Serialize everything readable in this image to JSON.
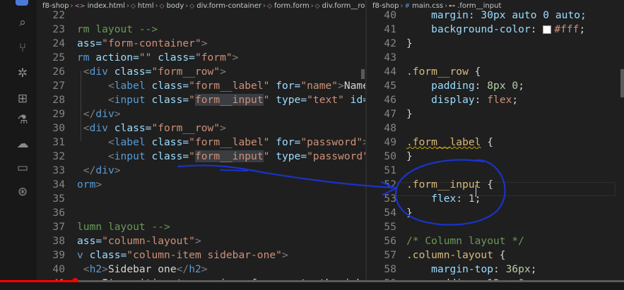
{
  "activity_bar": {
    "icons": [
      "files-icon",
      "search-icon",
      "source-control-icon",
      "debug-icon",
      "extensions-icon",
      "testing-icon",
      "docker-icon",
      "remote-explorer-icon",
      "git-graph-icon"
    ]
  },
  "left_editor": {
    "breadcrumb": [
      {
        "icon": "folder",
        "label": "f8-shop"
      },
      {
        "icon": "html",
        "label": "index.html"
      },
      {
        "icon": "element",
        "label": "html"
      },
      {
        "icon": "element",
        "label": "body"
      },
      {
        "icon": "element",
        "label": "div.form-container"
      },
      {
        "icon": "element",
        "label": "form.form"
      },
      {
        "icon": "element",
        "label": "div.form__row"
      },
      {
        "icon": "element",
        "label": ""
      }
    ],
    "lines": [
      {
        "num": "22",
        "tokens": []
      },
      {
        "num": "23",
        "tokens": [
          {
            "t": "rm layout -->",
            "c": "c-cm"
          }
        ]
      },
      {
        "num": "24",
        "tokens": [
          {
            "t": "ass=",
            "c": "c-attr"
          },
          {
            "t": "\"form-container\"",
            "c": "c-str"
          },
          {
            "t": ">",
            "c": "c-punc"
          }
        ]
      },
      {
        "num": "25",
        "tokens": [
          {
            "t": "rm ",
            "c": "c-tag"
          },
          {
            "t": "action=",
            "c": "c-attr"
          },
          {
            "t": "\"\" ",
            "c": "c-str"
          },
          {
            "t": "class=",
            "c": "c-attr"
          },
          {
            "t": "\"form\"",
            "c": "c-str"
          },
          {
            "t": ">",
            "c": "c-punc"
          }
        ]
      },
      {
        "num": "26",
        "tokens": [
          {
            "t": " ",
            "c": "c-plain"
          },
          {
            "t": "<",
            "c": "c-punc"
          },
          {
            "t": "div ",
            "c": "c-tag"
          },
          {
            "t": "class=",
            "c": "c-attr"
          },
          {
            "t": "\"form__row\"",
            "c": "c-str"
          },
          {
            "t": ">",
            "c": "c-punc"
          }
        ]
      },
      {
        "num": "27",
        "tokens": [
          {
            "t": "     ",
            "c": "c-plain"
          },
          {
            "t": "<",
            "c": "c-punc"
          },
          {
            "t": "label ",
            "c": "c-tag"
          },
          {
            "t": "class=",
            "c": "c-attr"
          },
          {
            "t": "\"form__label\" ",
            "c": "c-str"
          },
          {
            "t": "for=",
            "c": "c-attr"
          },
          {
            "t": "\"name\"",
            "c": "c-str"
          },
          {
            "t": ">",
            "c": "c-punc"
          },
          {
            "t": "Name:",
            "c": "c-plain"
          },
          {
            "t": "</l",
            "c": "c-punc"
          }
        ]
      },
      {
        "num": "28",
        "tokens": [
          {
            "t": "     ",
            "c": "c-plain"
          },
          {
            "t": "<",
            "c": "c-punc"
          },
          {
            "t": "input ",
            "c": "c-tag"
          },
          {
            "t": "class=",
            "c": "c-attr"
          },
          {
            "t": "\"",
            "c": "c-str"
          },
          {
            "t": "form__input",
            "c": "c-str hl"
          },
          {
            "t": "\" ",
            "c": "c-str"
          },
          {
            "t": "type=",
            "c": "c-attr"
          },
          {
            "t": "\"text\" ",
            "c": "c-str"
          },
          {
            "t": "id=",
            "c": "c-attr"
          },
          {
            "t": "\"nam",
            "c": "c-str"
          }
        ]
      },
      {
        "num": "29",
        "tokens": [
          {
            "t": " ",
            "c": "c-plain"
          },
          {
            "t": "</",
            "c": "c-punc"
          },
          {
            "t": "div",
            "c": "c-tag"
          },
          {
            "t": ">",
            "c": "c-punc"
          }
        ]
      },
      {
        "num": "30",
        "tokens": [
          {
            "t": " ",
            "c": "c-plain"
          },
          {
            "t": "<",
            "c": "c-punc"
          },
          {
            "t": "div ",
            "c": "c-tag"
          },
          {
            "t": "class=",
            "c": "c-attr"
          },
          {
            "t": "\"form__row\"",
            "c": "c-str"
          },
          {
            "t": ">",
            "c": "c-punc"
          }
        ]
      },
      {
        "num": "31",
        "tokens": [
          {
            "t": "     ",
            "c": "c-plain"
          },
          {
            "t": "<",
            "c": "c-punc"
          },
          {
            "t": "label ",
            "c": "c-tag"
          },
          {
            "t": "class=",
            "c": "c-attr"
          },
          {
            "t": "\"form__label\" ",
            "c": "c-str"
          },
          {
            "t": "for=",
            "c": "c-attr"
          },
          {
            "t": "\"password\"",
            "c": "c-str"
          },
          {
            "t": ">",
            "c": "c-punc"
          },
          {
            "t": "Pass",
            "c": "c-plain"
          }
        ]
      },
      {
        "num": "32",
        "tokens": [
          {
            "t": "     ",
            "c": "c-plain"
          },
          {
            "t": "<",
            "c": "c-punc"
          },
          {
            "t": "input ",
            "c": "c-tag"
          },
          {
            "t": "class=",
            "c": "c-attr"
          },
          {
            "t": "\"",
            "c": "c-str"
          },
          {
            "t": "form__input",
            "c": "c-str hl"
          },
          {
            "t": "\" ",
            "c": "c-str"
          },
          {
            "t": "type=",
            "c": "c-attr"
          },
          {
            "t": "\"password\" ",
            "c": "c-str"
          },
          {
            "t": "id=",
            "c": "c-attr"
          }
        ]
      },
      {
        "num": "33",
        "tokens": [
          {
            "t": " ",
            "c": "c-plain"
          },
          {
            "t": "</",
            "c": "c-punc"
          },
          {
            "t": "div",
            "c": "c-tag"
          },
          {
            "t": ">",
            "c": "c-punc"
          }
        ]
      },
      {
        "num": "34",
        "tokens": [
          {
            "t": "orm",
            "c": "c-tag"
          },
          {
            "t": ">",
            "c": "c-punc"
          }
        ]
      },
      {
        "num": "35",
        "tokens": []
      },
      {
        "num": "36",
        "tokens": []
      },
      {
        "num": "37",
        "tokens": [
          {
            "t": "lumn layout -->",
            "c": "c-cm"
          }
        ]
      },
      {
        "num": "38",
        "tokens": [
          {
            "t": "ass=",
            "c": "c-attr"
          },
          {
            "t": "\"column-layout\"",
            "c": "c-str"
          },
          {
            "t": ">",
            "c": "c-punc"
          }
        ]
      },
      {
        "num": "39",
        "tokens": [
          {
            "t": "v ",
            "c": "c-tag"
          },
          {
            "t": "class=",
            "c": "c-attr"
          },
          {
            "t": "\"column-item sidebar-one\"",
            "c": "c-str"
          },
          {
            "t": ">",
            "c": "c-punc"
          }
        ]
      },
      {
        "num": "40",
        "tokens": [
          {
            "t": " ",
            "c": "c-plain"
          },
          {
            "t": "<",
            "c": "c-punc"
          },
          {
            "t": "h2",
            "c": "c-tag"
          },
          {
            "t": ">",
            "c": "c-punc"
          },
          {
            "t": "Sidebar one",
            "c": "c-plain"
          },
          {
            "t": "</",
            "c": "c-punc"
          },
          {
            "t": "h2",
            "c": "c-tag"
          },
          {
            "t": ">",
            "c": "c-punc"
          }
        ]
      },
      {
        "num": "41",
        "tokens": [
          {
            "t": " ",
            "c": "c-plain"
          },
          {
            "t": "<",
            "c": "c-punc"
          },
          {
            "t": "p",
            "c": "c-tag"
          },
          {
            "t": ">",
            "c": "c-punc"
          },
          {
            "t": "I'm writing to you in reference to the job posi",
            "c": "c-plain"
          }
        ]
      }
    ]
  },
  "right_editor": {
    "breadcrumb": [
      {
        "icon": "folder",
        "label": "f8-shop"
      },
      {
        "icon": "css",
        "label": "main.css"
      },
      {
        "icon": "selector",
        "label": ".form__input"
      }
    ],
    "lines": [
      {
        "num": "40",
        "tokens": [
          {
            "t": "    margin: 30px auto 0 auto;",
            "c": "c-prop"
          }
        ]
      },
      {
        "num": "41",
        "tokens": [
          {
            "t": "    ",
            "c": "c-plain"
          },
          {
            "t": "background-color",
            "c": "c-prop"
          },
          {
            "t": ": ",
            "c": "c-plain"
          },
          {
            "t": "SWATCH",
            "c": "swatch"
          },
          {
            "t": "#fff",
            "c": "c-val"
          },
          {
            "t": ";",
            "c": "c-plain"
          }
        ]
      },
      {
        "num": "42",
        "tokens": [
          {
            "t": "}",
            "c": "c-brace"
          }
        ]
      },
      {
        "num": "43",
        "tokens": []
      },
      {
        "num": "44",
        "tokens": [
          {
            "t": ".form__row",
            "c": "c-sel"
          },
          {
            "t": " {",
            "c": "c-brace"
          }
        ]
      },
      {
        "num": "45",
        "tokens": [
          {
            "t": "    ",
            "c": "c-plain"
          },
          {
            "t": "padding",
            "c": "c-prop"
          },
          {
            "t": ": ",
            "c": "c-plain"
          },
          {
            "t": "8px 0",
            "c": "c-num"
          },
          {
            "t": ";",
            "c": "c-plain"
          }
        ]
      },
      {
        "num": "46",
        "tokens": [
          {
            "t": "    ",
            "c": "c-plain"
          },
          {
            "t": "display",
            "c": "c-prop"
          },
          {
            "t": ": ",
            "c": "c-plain"
          },
          {
            "t": "flex",
            "c": "c-val"
          },
          {
            "t": ";",
            "c": "c-plain"
          }
        ]
      },
      {
        "num": "47",
        "tokens": [
          {
            "t": "}",
            "c": "c-brace"
          }
        ]
      },
      {
        "num": "48",
        "tokens": []
      },
      {
        "num": "49",
        "tokens": [
          {
            "t": ".form__label",
            "c": "c-sel squiggle"
          },
          {
            "t": " {",
            "c": "c-brace"
          }
        ]
      },
      {
        "num": "50",
        "tokens": [
          {
            "t": "}",
            "c": "c-brace"
          }
        ]
      },
      {
        "num": "51",
        "tokens": []
      },
      {
        "num": "52",
        "tokens": [
          {
            "t": ".form__input",
            "c": "c-sel"
          },
          {
            "t": " {",
            "c": "c-brace"
          }
        ]
      },
      {
        "num": "53",
        "tokens": [
          {
            "t": "    ",
            "c": "c-plain"
          },
          {
            "t": "flex",
            "c": "c-prop"
          },
          {
            "t": ": ",
            "c": "c-plain"
          },
          {
            "t": "1",
            "c": "c-num"
          },
          {
            "t": ";",
            "c": "c-plain"
          }
        ]
      },
      {
        "num": "54",
        "tokens": [
          {
            "t": "}",
            "c": "c-brace"
          }
        ]
      },
      {
        "num": "55",
        "tokens": []
      },
      {
        "num": "56",
        "tokens": [
          {
            "t": "/* Column layout */",
            "c": "c-cm"
          }
        ]
      },
      {
        "num": "57",
        "tokens": [
          {
            "t": ".column-layout",
            "c": "c-sel"
          },
          {
            "t": " {",
            "c": "c-brace"
          }
        ]
      },
      {
        "num": "58",
        "tokens": [
          {
            "t": "    ",
            "c": "c-plain"
          },
          {
            "t": "margin-top",
            "c": "c-prop"
          },
          {
            "t": ": ",
            "c": "c-plain"
          },
          {
            "t": "36px",
            "c": "c-num"
          },
          {
            "t": ";",
            "c": "c-plain"
          }
        ]
      },
      {
        "num": "59",
        "tokens": [
          {
            "t": "    ",
            "c": "c-plain"
          },
          {
            "t": "padding",
            "c": "c-prop"
          },
          {
            "t": ": ",
            "c": "c-plain"
          },
          {
            "t": "12px 0",
            "c": "c-num"
          },
          {
            "t": ";",
            "c": "c-plain"
          }
        ]
      }
    ]
  },
  "video_progress": {
    "played_fraction": 0.12
  },
  "colors": {
    "annotation_ink": "#1a33cc",
    "progress": "#ff0000"
  }
}
